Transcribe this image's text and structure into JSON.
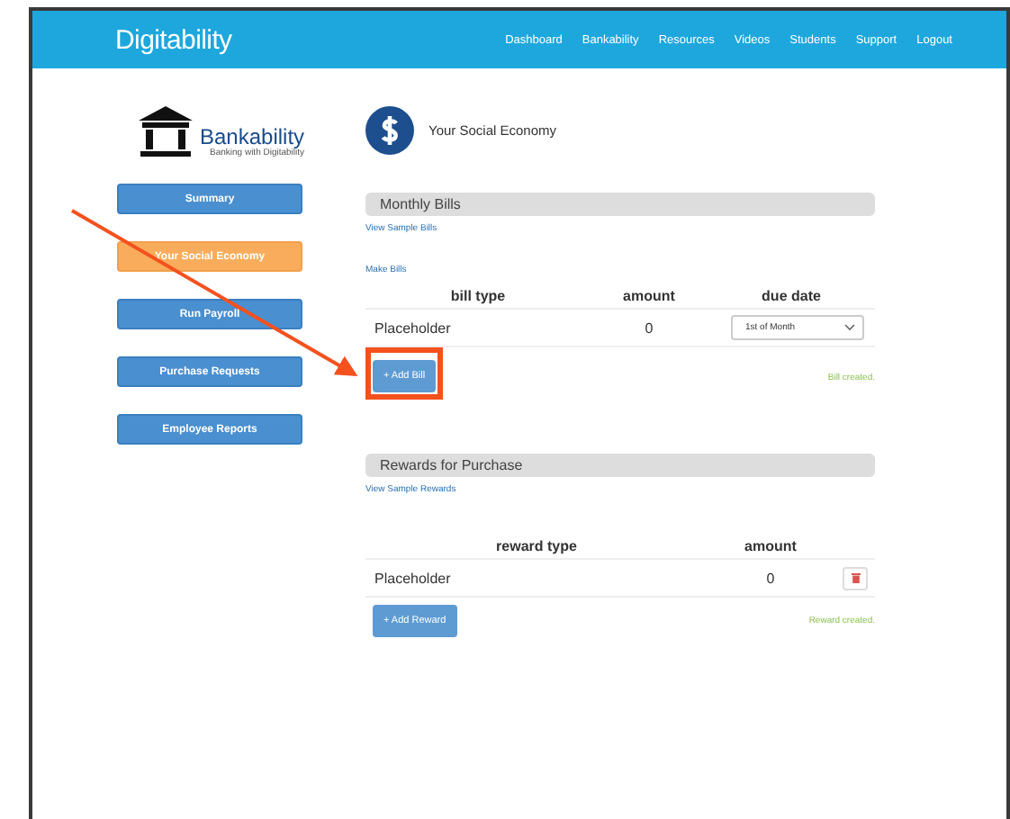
{
  "brand": "Digitability",
  "nav": [
    "Dashboard",
    "Bankability",
    "Resources",
    "Videos",
    "Students",
    "Support",
    "Logout"
  ],
  "sidebar": {
    "logo": {
      "name": "Bankability",
      "tagline": "Banking with Digitability"
    },
    "items": [
      {
        "label": "Summary",
        "selected": false
      },
      {
        "label": "Your Social Economy",
        "selected": true
      },
      {
        "label": "Run Payroll",
        "selected": false
      },
      {
        "label": "Purchase Requests",
        "selected": false
      },
      {
        "label": "Employee Reports",
        "selected": false
      }
    ]
  },
  "page_title": "Your Social Economy",
  "bills": {
    "title": "Monthly Bills",
    "sample_link": "View Sample Bills",
    "make_link": "Make Bills",
    "columns": [
      "bill type",
      "amount",
      "due date"
    ],
    "rows": [
      {
        "type": "Placeholder",
        "amount": "0",
        "due": "1st of Month"
      }
    ],
    "add_button": "+ Add Bill",
    "status": "Bill created."
  },
  "rewards": {
    "title": "Rewards for Purchase",
    "sample_link": "View Sample Rewards",
    "columns": [
      "reward type",
      "amount"
    ],
    "rows": [
      {
        "type": "Placeholder",
        "amount": "0"
      }
    ],
    "add_button": "+ Add Reward",
    "status": "Reward created."
  }
}
